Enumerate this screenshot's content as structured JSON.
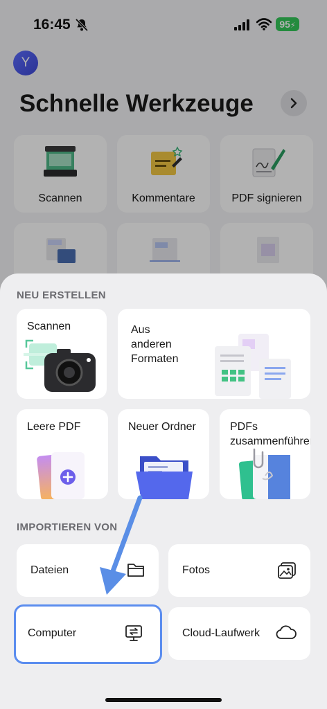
{
  "status": {
    "time": "16:45",
    "battery": "95"
  },
  "profile": {
    "initial": "Y"
  },
  "header": {
    "title": "Schnelle Werkzeuge"
  },
  "tools": [
    {
      "label": "Scannen"
    },
    {
      "label": "Kommentare"
    },
    {
      "label": "PDF signieren"
    }
  ],
  "sheet": {
    "create_title": "NEU ERSTELLEN",
    "create": {
      "scan": "Scannen",
      "other_formats": "Aus anderen Formaten",
      "blank_pdf": "Leere PDF",
      "new_folder": "Neuer Ordner",
      "merge_pdfs": "PDFs zusammenführen"
    },
    "import_title": "IMPORTIEREN VON",
    "import": {
      "files": "Dateien",
      "photos": "Fotos",
      "computer": "Computer",
      "cloud": "Cloud-Laufwerk"
    }
  },
  "colors": {
    "accent": "#5b8def",
    "folder": "#4e63e6",
    "battery": "#34c759"
  }
}
